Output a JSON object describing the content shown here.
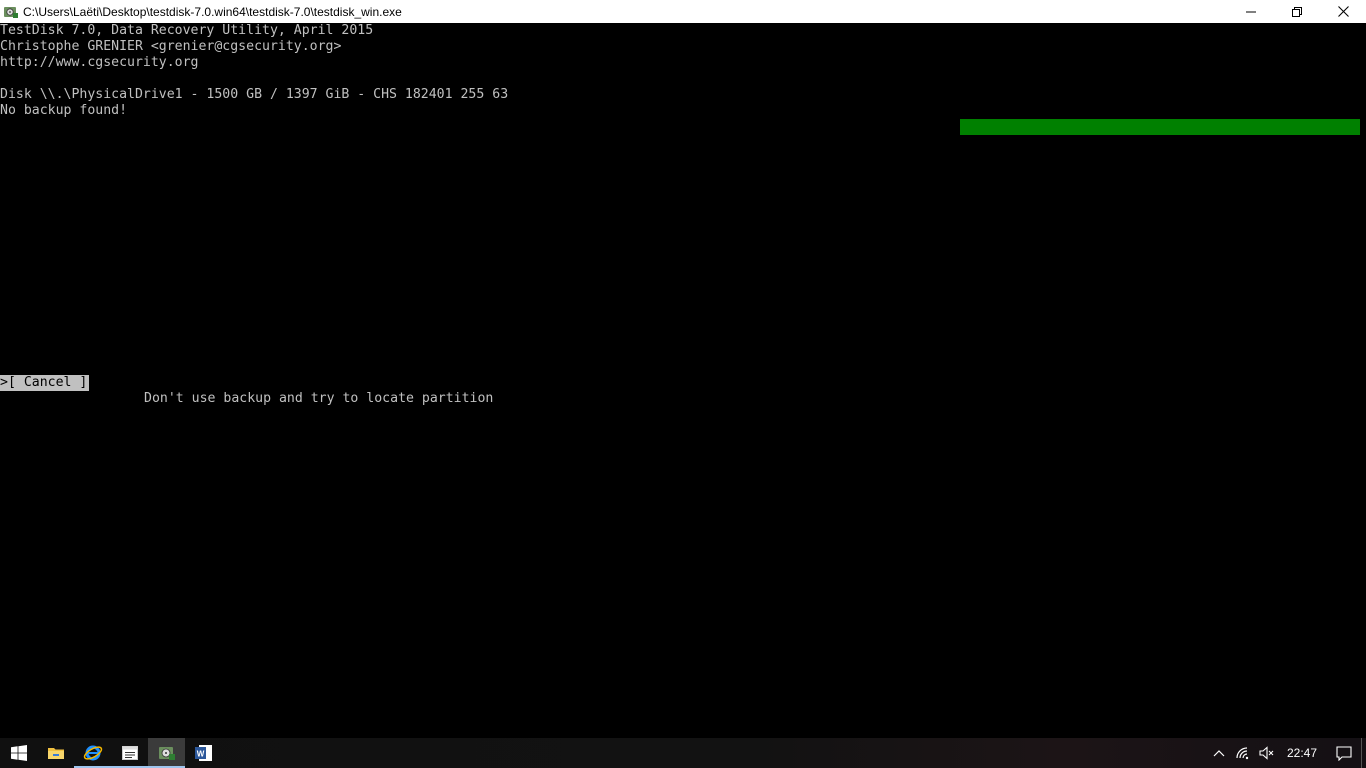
{
  "window": {
    "title": "C:\\Users\\Laëti\\Desktop\\testdisk-7.0.win64\\testdisk-7.0\\testdisk_win.exe",
    "icon": "testdisk-app-icon",
    "controls": [
      "minimize-icon",
      "restore-icon",
      "close-icon"
    ]
  },
  "console": {
    "header_lines": [
      "TestDisk 7.0, Data Recovery Utility, April 2015",
      "Christophe GRENIER <grenier@cgsecurity.org>",
      "http://www.cgsecurity.org"
    ],
    "disk_line": "Disk \\\\.\\PhysicalDrive1 - 1500 GB / 1397 GiB - CHS 182401 255 63",
    "status_line": "No backup found!",
    "progress_color": "#008000",
    "cancel_label": ">[ Cancel ]",
    "hint_text": "Don't use backup and try to locate partition"
  },
  "taskbar": {
    "items": [
      {
        "icon": "windows-start-icon"
      },
      {
        "icon": "file-explorer-icon"
      },
      {
        "icon": "internet-explorer-icon"
      },
      {
        "icon": "console-window-icon"
      },
      {
        "icon": "testdisk-icon",
        "active": true
      },
      {
        "icon": "word-icon"
      }
    ],
    "tray_icons": [
      "chevron-up-icon",
      "wifi-icon",
      "volume-muted-icon"
    ],
    "clock": "22:47",
    "notification_icon": "action-center-icon",
    "accent_color": "#9ec5ee"
  }
}
